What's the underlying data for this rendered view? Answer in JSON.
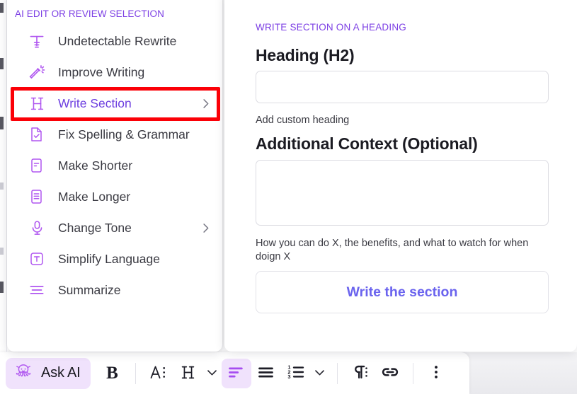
{
  "menu": {
    "header": "AI EDIT OR REVIEW SELECTION",
    "items": [
      {
        "label": "Undetectable Rewrite",
        "icon": "text-rewrite-icon",
        "has_submenu": false,
        "selected": false
      },
      {
        "label": "Improve Writing",
        "icon": "magic-wand-icon",
        "has_submenu": false,
        "selected": false
      },
      {
        "label": "Write Section",
        "icon": "heading-h-icon",
        "has_submenu": true,
        "selected": true
      },
      {
        "label": "Fix Spelling & Grammar",
        "icon": "document-check-icon",
        "has_submenu": false,
        "selected": false
      },
      {
        "label": "Make Shorter",
        "icon": "document-short-icon",
        "has_submenu": false,
        "selected": false
      },
      {
        "label": "Make Longer",
        "icon": "document-lines-icon",
        "has_submenu": false,
        "selected": false
      },
      {
        "label": "Change Tone",
        "icon": "microphone-icon",
        "has_submenu": true,
        "selected": false
      },
      {
        "label": "Simplify Language",
        "icon": "letter-t-icon",
        "has_submenu": false,
        "selected": false
      },
      {
        "label": "Summarize",
        "icon": "summarize-lines-icon",
        "has_submenu": false,
        "selected": false
      }
    ]
  },
  "form": {
    "eyebrow": "WRITE SECTION ON A HEADING",
    "heading_label": "Heading (H2)",
    "heading_value": "",
    "heading_placeholder": "",
    "heading_helper": "Add custom heading",
    "context_label": "Additional Context (Optional)",
    "context_value": "",
    "context_placeholder": "",
    "context_helper": "How you can do X, the benefits, and what to watch for when doign X",
    "submit_label": "Write the section"
  },
  "toolbar": {
    "ask_ai_label": "Ask AI",
    "ask_ai_icon": "octopus-icon",
    "bold_label": "B",
    "buttons": [
      {
        "name": "font-size-button",
        "icon": "font-size-icon"
      },
      {
        "name": "heading-style-button",
        "icon": "heading-h-icon"
      },
      {
        "name": "heading-dropdown-caret",
        "icon": "chevron-down-icon"
      },
      {
        "name": "align-left-button",
        "icon": "align-left-icon"
      },
      {
        "name": "bullet-list-button",
        "icon": "bullet-list-icon"
      },
      {
        "name": "numbered-list-button",
        "icon": "numbered-list-icon"
      },
      {
        "name": "list-dropdown-caret",
        "icon": "chevron-down-icon"
      },
      {
        "name": "paragraph-style-button",
        "icon": "pilcrow-icon"
      },
      {
        "name": "insert-link-button",
        "icon": "link-icon"
      },
      {
        "name": "more-options-button",
        "icon": "kebab-menu-icon"
      }
    ]
  },
  "colors": {
    "accent_purple": "#7c3fe4",
    "icon_purple": "#b057f0",
    "selected_label": "#6d3fe0",
    "button_blue": "#6a63ee",
    "highlight_red": "#fb0007",
    "chip_bg": "#f0e2fc"
  }
}
